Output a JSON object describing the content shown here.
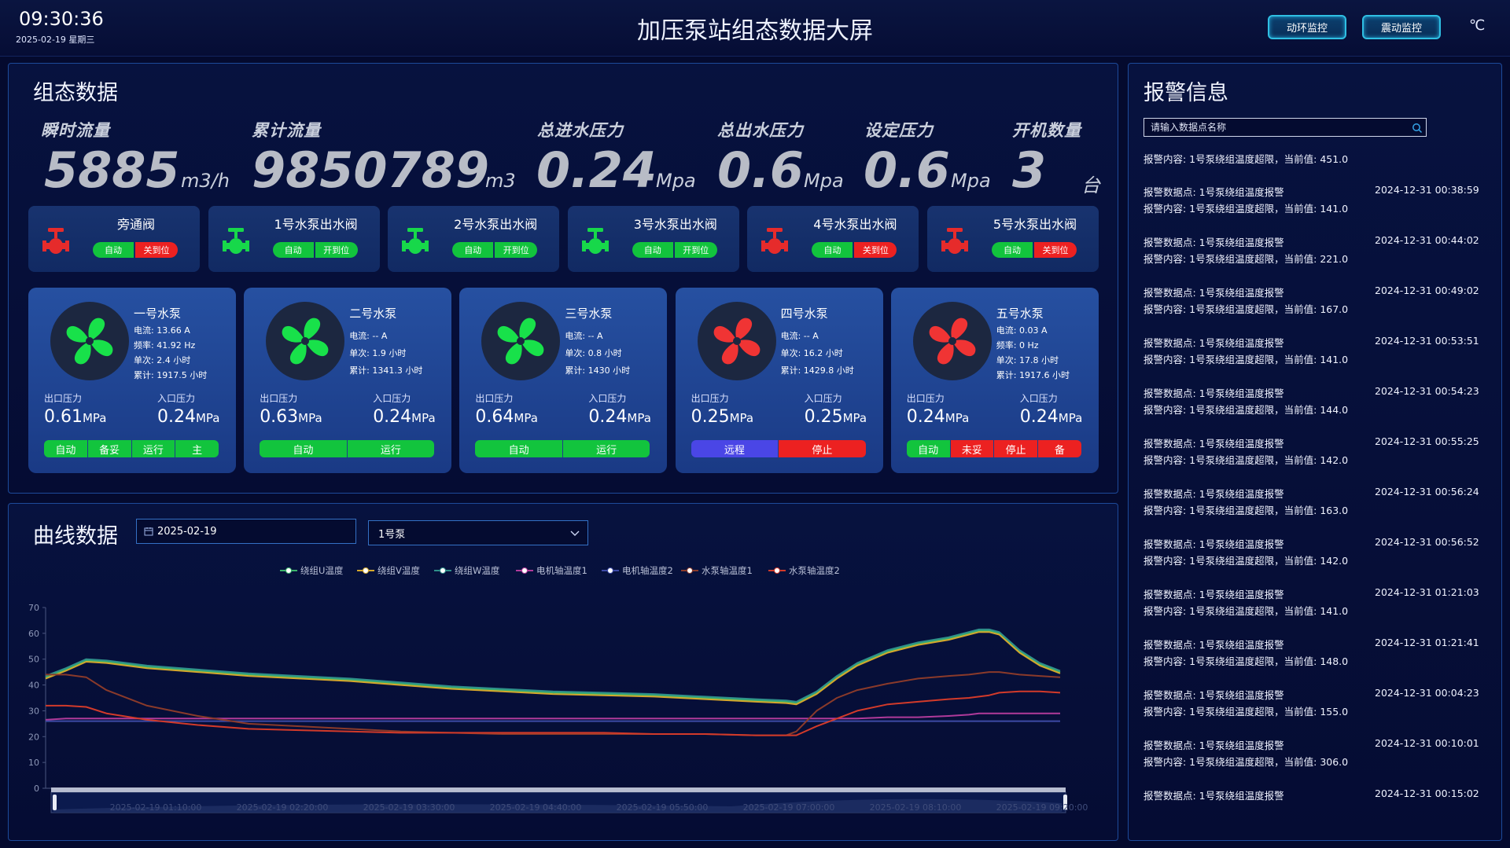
{
  "header": {
    "time": "09:30:36",
    "date": "2025-02-19 星期三",
    "title": "加压泵站组态数据大屏",
    "btn_env": "动环监控",
    "btn_vibration": "震动监控",
    "unit": "℃"
  },
  "config_panel": {
    "title": "组态数据",
    "metrics": [
      {
        "label": "瞬时流量",
        "value": "5885",
        "unit": "m3/h"
      },
      {
        "label": "累计流量",
        "value": "9850789",
        "unit": "m3"
      },
      {
        "label": "总进水压力",
        "value": "0.24",
        "unit": "Mpa"
      },
      {
        "label": "总出水压力",
        "value": "0.6",
        "unit": "Mpa"
      },
      {
        "label": "设定压力",
        "value": "0.6",
        "unit": "Mpa"
      },
      {
        "label": "开机数量",
        "value": "3",
        "unit": "台"
      }
    ],
    "valves": [
      {
        "name": "旁通阀",
        "mode": "自动",
        "state": "关到位",
        "color": "#e62b2b",
        "state_color": "#ec2121"
      },
      {
        "name": "1号水泵出水阀",
        "mode": "自动",
        "state": "开到位",
        "color": "#17d84a",
        "state_color": "#12c43d"
      },
      {
        "name": "2号水泵出水阀",
        "mode": "自动",
        "state": "开到位",
        "color": "#17d84a",
        "state_color": "#12c43d"
      },
      {
        "name": "3号水泵出水阀",
        "mode": "自动",
        "state": "开到位",
        "color": "#17d84a",
        "state_color": "#12c43d"
      },
      {
        "name": "4号水泵出水阀",
        "mode": "自动",
        "state": "关到位",
        "color": "#e62b2b",
        "state_color": "#ec2121"
      },
      {
        "name": "5号水泵出水阀",
        "mode": "自动",
        "state": "关到位",
        "color": "#e62b2b",
        "state_color": "#ec2121"
      }
    ],
    "pumps": [
      {
        "name": "一号水泵",
        "fan_color": "#18e14a",
        "stats": [
          "电流:  13.66 A",
          "频率:  41.92 Hz",
          "单次:  2.4 小时",
          "累计:  1917.5 小时"
        ],
        "out_label": "出口压力",
        "out_value": "0.61",
        "in_label": "入口压力",
        "in_value": "0.24",
        "unit": "MPa",
        "buttons": [
          {
            "label": "自动",
            "color": "#12c43d"
          },
          {
            "label": "备妥",
            "color": "#12c43d"
          },
          {
            "label": "运行",
            "color": "#12c43d"
          },
          {
            "label": "主",
            "color": "#12c43d"
          }
        ]
      },
      {
        "name": "二号水泵",
        "fan_color": "#18e14a",
        "stats": [
          "电流:  -- A",
          "单次:  1.9 小时",
          "累计:  1341.3 小时"
        ],
        "out_label": "出口压力",
        "out_value": "0.63",
        "in_label": "入口压力",
        "in_value": "0.24",
        "unit": "MPa",
        "buttons": [
          {
            "label": "自动",
            "color": "#12c43d"
          },
          {
            "label": "运行",
            "color": "#12c43d"
          }
        ]
      },
      {
        "name": "三号水泵",
        "fan_color": "#18e14a",
        "stats": [
          "电流:  -- A",
          "单次:  0.8 小时",
          "累计:  1430 小时"
        ],
        "out_label": "出口压力",
        "out_value": "0.64",
        "in_label": "入口压力",
        "in_value": "0.24",
        "unit": "MPa",
        "buttons": [
          {
            "label": "自动",
            "color": "#12c43d"
          },
          {
            "label": "运行",
            "color": "#12c43d"
          }
        ]
      },
      {
        "name": "四号水泵",
        "fan_color": "#f03434",
        "stats": [
          "电流:  -- A",
          "单次:  16.2 小时",
          "累计:  1429.8 小时"
        ],
        "out_label": "出口压力",
        "out_value": "0.25",
        "in_label": "入口压力",
        "in_value": "0.25",
        "unit": "MPa",
        "buttons": [
          {
            "label": "远程",
            "color": "#4a46e6"
          },
          {
            "label": "停止",
            "color": "#ec2121"
          }
        ]
      },
      {
        "name": "五号水泵",
        "fan_color": "#f03434",
        "stats": [
          "电流:  0.03 A",
          "频率:  0 Hz",
          "单次:  17.8 小时",
          "累计:  1917.6 小时"
        ],
        "out_label": "出口压力",
        "out_value": "0.24",
        "in_label": "入口压力",
        "in_value": "0.24",
        "unit": "MPa",
        "buttons": [
          {
            "label": "自动",
            "color": "#12c43d"
          },
          {
            "label": "未妥",
            "color": "#ec2121"
          },
          {
            "label": "停止",
            "color": "#ec2121"
          },
          {
            "label": "备",
            "color": "#ec2121"
          }
        ]
      }
    ]
  },
  "alarm_panel": {
    "title": "报警信息",
    "search_placeholder": "请输入数据点名称",
    "first_content": "报警内容:  1号泵绕组温度超限，当前值:  451.0",
    "items": [
      {
        "point": "报警数据点:  1号泵绕组温度报警",
        "time": "2024-12-31 00:38:59",
        "content": "报警内容:  1号泵绕组温度超限，当前值:  141.0"
      },
      {
        "point": "报警数据点:  1号泵绕组温度报警",
        "time": "2024-12-31 00:44:02",
        "content": "报警内容:  1号泵绕组温度超限，当前值:  221.0"
      },
      {
        "point": "报警数据点:  1号泵绕组温度报警",
        "time": "2024-12-31 00:49:02",
        "content": "报警内容:  1号泵绕组温度超限，当前值:  167.0"
      },
      {
        "point": "报警数据点:  1号泵绕组温度报警",
        "time": "2024-12-31 00:53:51",
        "content": "报警内容:  1号泵绕组温度超限，当前值:  141.0"
      },
      {
        "point": "报警数据点:  1号泵绕组温度报警",
        "time": "2024-12-31 00:54:23",
        "content": "报警内容:  1号泵绕组温度超限，当前值:  144.0"
      },
      {
        "point": "报警数据点:  1号泵绕组温度报警",
        "time": "2024-12-31 00:55:25",
        "content": "报警内容:  1号泵绕组温度超限，当前值:  142.0"
      },
      {
        "point": "报警数据点:  1号泵绕组温度报警",
        "time": "2024-12-31 00:56:24",
        "content": "报警内容:  1号泵绕组温度超限，当前值:  163.0"
      },
      {
        "point": "报警数据点:  1号泵绕组温度报警",
        "time": "2024-12-31 00:56:52",
        "content": "报警内容:  1号泵绕组温度超限，当前值:  142.0"
      },
      {
        "point": "报警数据点:  1号泵绕组温度报警",
        "time": "2024-12-31 01:21:03",
        "content": "报警内容:  1号泵绕组温度超限，当前值:  141.0"
      },
      {
        "point": "报警数据点:  1号泵绕组温度报警",
        "time": "2024-12-31 01:21:41",
        "content": "报警内容:  1号泵绕组温度超限，当前值:  148.0"
      },
      {
        "point": "报警数据点:  1号泵绕组温度报警",
        "time": "2024-12-31 00:04:23",
        "content": "报警内容:  1号泵绕组温度超限，当前值:  155.0"
      },
      {
        "point": "报警数据点:  1号泵绕组温度报警",
        "time": "2024-12-31 00:10:01",
        "content": "报警内容:  1号泵绕组温度超限，当前值:  306.0"
      },
      {
        "point": "报警数据点:  1号泵绕组温度报警",
        "time": "2024-12-31 00:15:02",
        "content": ""
      }
    ]
  },
  "curve_panel": {
    "title": "曲线数据",
    "date_value": "2025-02-19",
    "pump_select": "1号泵",
    "chart_data": {
      "type": "line",
      "title": "",
      "xlabel": "",
      "ylabel": "",
      "ylim": [
        0,
        70
      ],
      "y_ticks": [
        "0",
        "10",
        "20",
        "30",
        "40",
        "50",
        "60",
        "70"
      ],
      "x_ticks": [
        "2025-02-19 01:10:00",
        "2025-02-19 02:20:00",
        "2025-02-19 03:30:00",
        "2025-02-19 04:40:00",
        "2025-02-19 05:50:00",
        "2025-02-19 07:00:00",
        "2025-02-19 08:10:00",
        "2025-02-19 09:20:00"
      ],
      "x": [
        0,
        0.02,
        0.04,
        0.06,
        0.1,
        0.15,
        0.2,
        0.25,
        0.3,
        0.35,
        0.4,
        0.45,
        0.5,
        0.55,
        0.6,
        0.65,
        0.7,
        0.73,
        0.74,
        0.76,
        0.78,
        0.8,
        0.83,
        0.86,
        0.89,
        0.91,
        0.92,
        0.93,
        0.94,
        0.96,
        0.98,
        1.0
      ],
      "series": [
        {
          "name": "绕组U温度",
          "color": "#3bb36b",
          "values": [
            43,
            46,
            49.5,
            49,
            47,
            45.5,
            44,
            43,
            42,
            40.5,
            39,
            38,
            37,
            36.5,
            36,
            35,
            34,
            33.5,
            33,
            37,
            43,
            48,
            53,
            56,
            58,
            60,
            61,
            61,
            60,
            53,
            48,
            45
          ]
        },
        {
          "name": "绕组V温度",
          "color": "#d4a72c",
          "values": [
            42.5,
            45.5,
            49,
            48.5,
            46.5,
            45,
            43.5,
            42.5,
            41.5,
            40,
            38.5,
            37.5,
            36.5,
            36,
            35.5,
            34.5,
            33.5,
            33,
            32.5,
            36.5,
            42.5,
            47.5,
            52.5,
            55.5,
            57.5,
            59.5,
            60.5,
            60.5,
            59.5,
            52.5,
            47.5,
            44.5
          ]
        },
        {
          "name": "绕组W温度",
          "color": "#2f8f8a",
          "values": [
            43.5,
            46.5,
            50,
            49.5,
            47.5,
            46,
            44.5,
            43.5,
            42.5,
            41,
            39.5,
            38.5,
            37.5,
            37,
            36.5,
            35.5,
            34.5,
            34,
            33.5,
            37.5,
            43.5,
            48.5,
            53.5,
            56.5,
            58.5,
            60.5,
            61.5,
            61.5,
            60.5,
            53.5,
            48.5,
            45.5
          ]
        },
        {
          "name": "电机轴温度1",
          "color": "#b03a9a",
          "values": [
            26.5,
            27,
            27,
            27,
            27,
            27,
            27,
            27,
            27,
            27,
            27,
            27,
            27,
            27,
            27,
            27,
            27,
            27,
            27,
            27,
            27,
            27,
            27.5,
            27.5,
            28,
            28.5,
            29,
            29,
            29,
            29,
            29,
            29
          ]
        },
        {
          "name": "电机轴温度2",
          "color": "#3d4aa6",
          "values": [
            26,
            26,
            26,
            26,
            26,
            26,
            26,
            26,
            26,
            26,
            26,
            26,
            26,
            26,
            26,
            26,
            26,
            26,
            26,
            26,
            26,
            26,
            26,
            26,
            26,
            26,
            26,
            26,
            26,
            26,
            26,
            26
          ]
        },
        {
          "name": "水泵轴温度1",
          "color": "#8a3a2a",
          "values": [
            44,
            44,
            43,
            38,
            32,
            28,
            25,
            24,
            23,
            22,
            21.5,
            21,
            21,
            21,
            21,
            21,
            20.5,
            20.5,
            22,
            30,
            35,
            38,
            40.5,
            42.5,
            43.5,
            44,
            44.5,
            45,
            45,
            44,
            43.5,
            43
          ]
        },
        {
          "name": "水泵轴温度2",
          "color": "#d23a2a",
          "values": [
            32,
            32,
            31.5,
            29,
            26.5,
            24.5,
            23,
            22.5,
            22,
            21.5,
            21.5,
            21.5,
            21.5,
            21.5,
            21,
            21,
            20.5,
            20.5,
            20.5,
            24,
            27,
            30,
            32.5,
            33.5,
            34.5,
            35,
            35.5,
            36,
            37,
            37.5,
            37.5,
            37
          ]
        }
      ]
    }
  }
}
